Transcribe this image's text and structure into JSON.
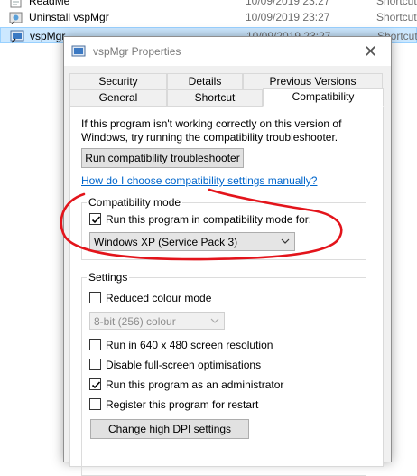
{
  "explorer": {
    "rows": [
      {
        "name": "ReadMe",
        "date": "10/09/2019 23:27",
        "type": "Shortcut"
      },
      {
        "name": "Uninstall vspMgr",
        "date": "10/09/2019 23:27",
        "type": "Shortcut"
      },
      {
        "name": "vspMgr",
        "date": "10/09/2019 23:27",
        "type": "Shortcut"
      }
    ]
  },
  "dialog": {
    "title": "vspMgr Properties",
    "close_glyph": "✕",
    "tabs_back": [
      "Security",
      "Details",
      "Previous Versions"
    ],
    "tabs_front": [
      "General",
      "Shortcut",
      "Compatibility"
    ],
    "active_tab": "Compatibility"
  },
  "compat": {
    "intro": "If this program isn't working correctly on this version of Windows, try running the compatibility troubleshooter.",
    "troubleshooter_button": "Run compatibility troubleshooter",
    "help_link": "How do I choose compatibility settings manually?",
    "mode_group_label": "Compatibility mode",
    "mode_checkbox_label": "Run this program in compatibility mode for:",
    "mode_checked": true,
    "mode_selected": "Windows XP (Service Pack 3)"
  },
  "settings": {
    "group_label": "Settings",
    "reduced_colour_label": "Reduced colour mode",
    "reduced_colour_checked": false,
    "colour_select_value": "8-bit (256) colour",
    "res640_label": "Run in 640 x 480 screen resolution",
    "res640_checked": false,
    "fullscreen_label": "Disable full-screen optimisations",
    "fullscreen_checked": false,
    "admin_label": "Run this program as an administrator",
    "admin_checked": true,
    "restart_label": "Register this program for restart",
    "restart_checked": false,
    "dpi_button": "Change high DPI settings"
  },
  "colors": {
    "annotation": "#e3141b",
    "link": "#0066cc",
    "selection": "#cce8ff"
  }
}
